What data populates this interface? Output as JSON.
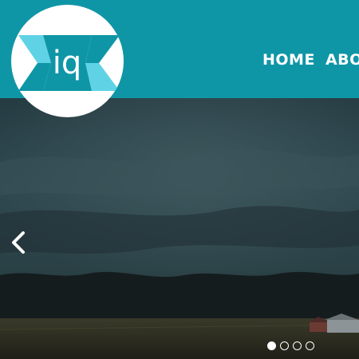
{
  "brand": {
    "logo_text": "iq",
    "colors": {
      "header_bg": "#0f96a6",
      "logo_light": "#5fd3e5",
      "logo_dark": "#0f96a6"
    }
  },
  "nav": {
    "items": [
      {
        "label": "HOME"
      },
      {
        "label": "ABO"
      }
    ]
  },
  "slider": {
    "prev_icon": "chevron-left-icon",
    "dots": [
      {
        "active": true
      },
      {
        "active": false
      },
      {
        "active": false
      },
      {
        "active": false
      }
    ]
  }
}
